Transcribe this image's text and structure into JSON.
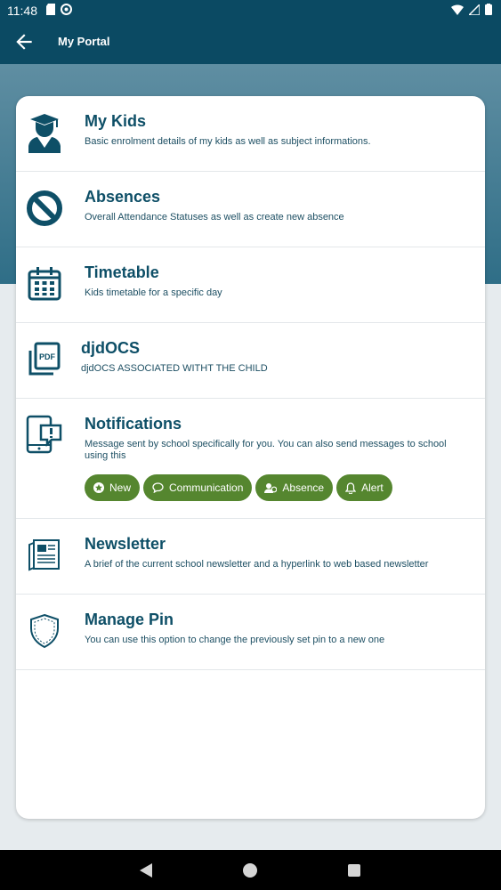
{
  "status_bar": {
    "time": "11:48"
  },
  "app_bar": {
    "title": "My Portal"
  },
  "menu": [
    {
      "title": "My Kids",
      "desc": "Basic enrolment details of my kids as well as subject informations.",
      "icon": "graduate-icon"
    },
    {
      "title": "Absences",
      "desc": "Overall Attendance Statuses as well as create new absence",
      "icon": "ban-icon"
    },
    {
      "title": "Timetable",
      "desc": "Kids timetable for a specific day",
      "icon": "calendar-icon"
    },
    {
      "title": "djdOCS",
      "desc": "djdOCS ASSOCIATED WITHT THE CHILD",
      "icon": "pdf-icon"
    },
    {
      "title": "Notifications",
      "desc": "Message sent by school specifically for you. You can also send messages to school using this",
      "icon": "notification-tablet-icon",
      "chips": [
        {
          "label": "New",
          "icon": "new-icon"
        },
        {
          "label": "Communication",
          "icon": "chat-icon"
        },
        {
          "label": "Absence",
          "icon": "absence-icon"
        },
        {
          "label": "Alert",
          "icon": "bell-icon"
        }
      ]
    },
    {
      "title": "Newsletter",
      "desc": "A brief of the current school newsletter and a hyperlink to web based newsletter",
      "icon": "newspaper-icon"
    },
    {
      "title": "Manage Pin",
      "desc": "You can use this option to change the previously set pin to a new one",
      "icon": "shield-icon"
    }
  ],
  "colors": {
    "primary": "#0b4a63",
    "accent_green": "#55862f",
    "text_dark": "#0e4f67"
  }
}
